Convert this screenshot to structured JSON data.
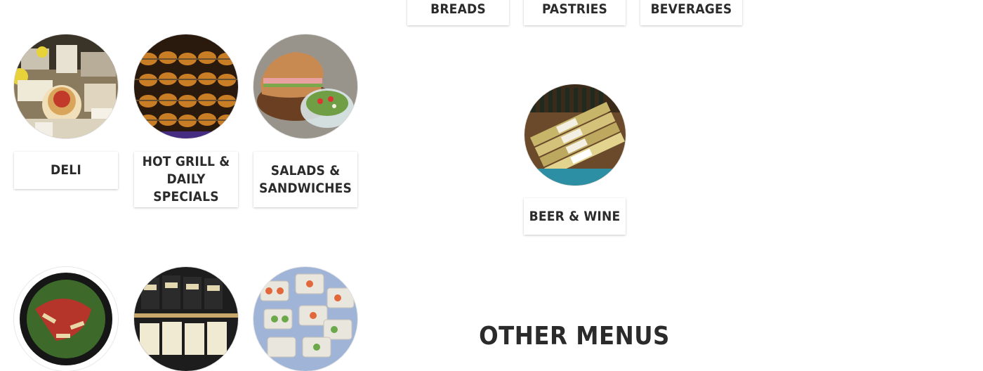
{
  "top_categories": [
    {
      "label": "BREADS"
    },
    {
      "label": "PASTRIES"
    },
    {
      "label": "BEVERAGES"
    }
  ],
  "left_categories": [
    {
      "label": "DELI",
      "image": "deli-photo"
    },
    {
      "label": "HOT GRILL & DAILY SPECIALS",
      "image": "rotisserie-chicken-photo"
    },
    {
      "label": "SALADS & SANDWICHES",
      "image": "sandwich-salad-photo"
    }
  ],
  "right_categories": [
    {
      "label": "BEER & WINE",
      "image": "wine-bottles-photo"
    }
  ],
  "bottom_row_images": [
    "pasta-photo",
    "chips-photo",
    "sushi-photo"
  ],
  "other_menus": {
    "heading": "OTHER MENUS"
  }
}
